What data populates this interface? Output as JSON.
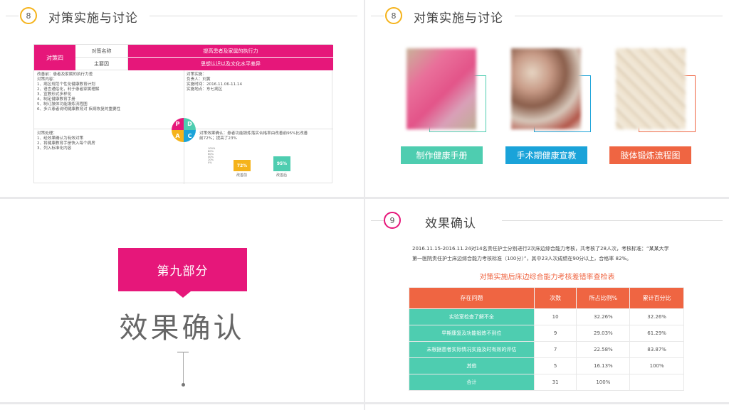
{
  "slide1": {
    "number": "8",
    "title": "对策实施与讨论",
    "table": {
      "strategy_label": "对策四",
      "name_label": "对策名称",
      "name_value": "提高患者及家属的执行力",
      "cause_label": "主要因",
      "cause_value": "思想认识以及文化水平差异",
      "plan_lines": [
        "改善前：患者及家属的执行力差",
        "对策内容：",
        "1、病区规范个性化健康教育计划",
        "2、语言通俗化，利于患者家属理解",
        "3、宣教形式多样化",
        "4、制定健康教育手册",
        "5、制订肢体功能锻炼流程图",
        "6、多兴患者说明健康教育对 疾病恢复的重要性"
      ],
      "do_lines": [
        "对策实施：",
        "负责人：刘黄",
        "实施时间：2016.11.06-11.14",
        "实施地点：东七病区"
      ],
      "act_lines": [
        "对策处理：",
        "1、经效果确认为有效对策",
        "2、将健康教育手册快入每个病房",
        "3、列入标准化内容"
      ],
      "check_text_1": "对策效果确认：患者功能锻炼落实合格率由改善前95%比改善",
      "check_text_2": "前72%；提高了23%",
      "pdca": {
        "p": "P",
        "d": "D",
        "a": "A",
        "c": "C"
      },
      "mini_chart": {
        "axis_ticks": [
          "100%",
          "80%",
          "60%",
          "40%",
          "20%",
          "0%"
        ],
        "bars": [
          {
            "label": "改善前",
            "value_label": "72%",
            "value": 72,
            "color": "#f5b31b"
          },
          {
            "label": "改善后",
            "value_label": "95%",
            "value": 95,
            "color": "#4ecdb0"
          }
        ]
      }
    }
  },
  "slide2": {
    "number": "8",
    "title": "对策实施与讨论",
    "items": [
      {
        "label": "制作健康手册",
        "color": "#4ecdb0"
      },
      {
        "label": "手术期健康宣教",
        "color": "#1aa3d9"
      },
      {
        "label": "肢体锻炼流程图",
        "color": "#ef6542"
      }
    ]
  },
  "slide3": {
    "section_label": "第九部分",
    "section_title": "效果确认"
  },
  "slide4": {
    "number": "9",
    "title": "效果确认",
    "para_line1": "2016.11.15-2016.11.24对14名责任护士分别进行2次床边综合能力考核，共考核了28人次，考核标准：“某某大学",
    "para_line2": "第一医院责任护士床边综合能力考核标准（100分）”，其中23人次成绩在90分以上，合格率 82%。",
    "table_title": "对策实施后床边综合能力考核差错率查检表",
    "headers": [
      "存在问题",
      "次数",
      "所占比例%",
      "累计百分比"
    ],
    "rows": [
      [
        "实验室检查了解不全",
        "10",
        "32.26%",
        "32.26%"
      ],
      [
        "早期康复及功能锻炼不到位",
        "9",
        "29.03%",
        "61.29%"
      ],
      [
        "未根据患者实际情况实施及时有效的评估",
        "7",
        "22.58%",
        "83.87%"
      ],
      [
        "其他",
        "5",
        "16.13%",
        "100%"
      ],
      [
        "合计",
        "31",
        "100%",
        ""
      ]
    ]
  },
  "colors": {
    "magenta": "#e6177a",
    "teal": "#4ecdb0",
    "blue": "#1aa3d9",
    "orange": "#ef6542",
    "yellow": "#f5b31b"
  }
}
